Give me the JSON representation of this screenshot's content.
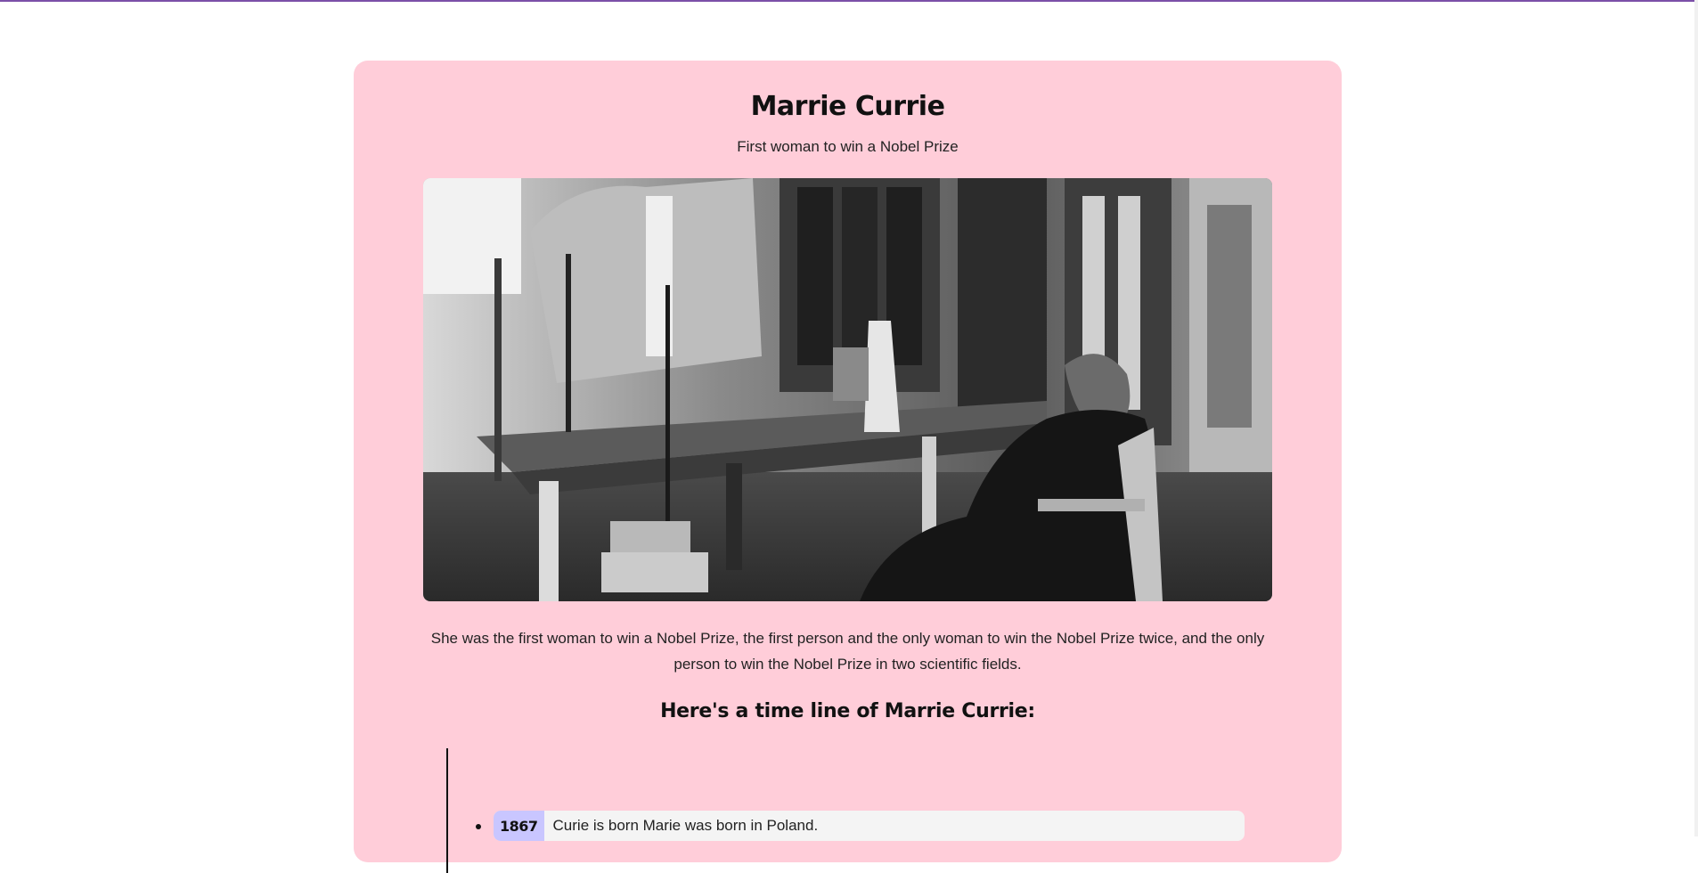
{
  "page": {
    "title": "Marrie Currie",
    "subtitle": "First woman to win a Nobel Prize",
    "description": "She was the first woman to win a Nobel Prize, the first person and the only woman to win the Nobel Prize twice, and the only person to win the Nobel Prize in two scientific fields.",
    "timeline_heading": "Here's a time line of Marrie Currie:"
  },
  "timeline": [
    {
      "year": "1867",
      "event": "Curie is born Marie was born in Poland."
    }
  ],
  "colors": {
    "accent_bar": "#7b4fa8",
    "card_background": "#ffcdd9",
    "year_badge": "#c9c6ff",
    "timeline_item_background": "#f4f4f4"
  },
  "icons": {
    "photo": "black-and-white-photo-of-scientist-in-laboratory"
  }
}
